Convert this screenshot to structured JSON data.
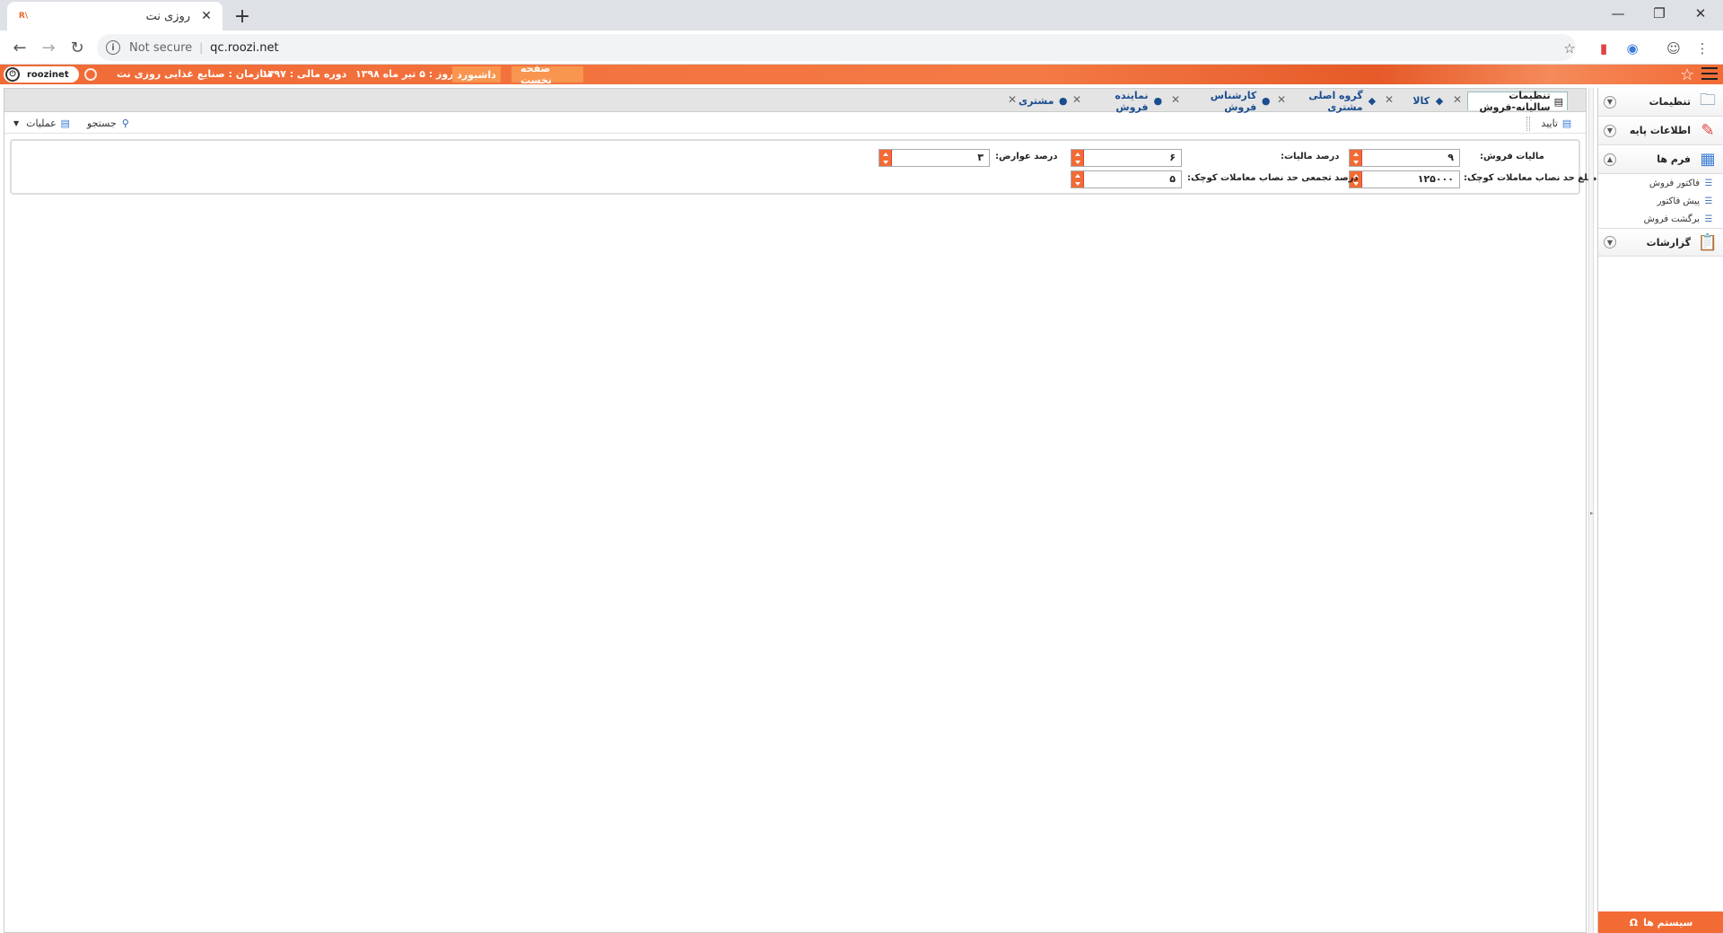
{
  "browser": {
    "tab_title": "روزی نت",
    "favicon_text": "R\\",
    "address": {
      "security": "Not secure",
      "url": "qc.roozi.net"
    }
  },
  "header": {
    "logo_text": "roozinet",
    "organization": "سازمان :  صنایع غذایی روزی نت",
    "fiscal_period": "دوره مالی :  ۱۳۹۷",
    "today": "امروز :  ۵ تیر ماه ۱۳۹۸",
    "dashboard_label": "داشبورد",
    "first_page_label": "صفحه نخست",
    "accent_color": "#f26b35"
  },
  "form_tabs": [
    {
      "label": "تنظیمات سالیانه-فروش",
      "icon": "settings-doc-icon"
    },
    {
      "label": "کالا",
      "icon": "goods-icon"
    },
    {
      "label": "گروه اصلی مشتری",
      "icon": "group-icon"
    },
    {
      "label": "کارشناس فروش",
      "icon": "user-icon"
    },
    {
      "label": "نماینده فروش",
      "icon": "user-icon"
    },
    {
      "label": "مشتری",
      "icon": "user-icon"
    }
  ],
  "toolbar": {
    "confirm_label": "تایید",
    "search_label": "جستجو",
    "operations_label": "عملیات"
  },
  "form": {
    "sales_tax_label": "مالیات فروش:",
    "sales_tax_value": "۹",
    "tax_percent_label": "درصد مالیات:",
    "tax_percent_value": "۶",
    "duties_percent_label": "درصد عوارض:",
    "duties_percent_value": "۳",
    "small_threshold_amount_label": "مبلغ حد نصاب معاملات کوچک:",
    "small_threshold_amount_value": "۱۲۵۰۰۰",
    "cumulative_threshold_label": "درصد تجمعی حد نصاب معاملات کوچک:",
    "cumulative_threshold_value": "۵"
  },
  "sidebar": {
    "groups": [
      {
        "label": "تنظیمات",
        "expanded": false
      },
      {
        "label": "اطلاعات پایه",
        "expanded": false
      },
      {
        "label": "فرم ها",
        "expanded": true,
        "items": [
          "فاکتور فروش",
          "پیش فاکتور",
          "برگشت فروش"
        ]
      },
      {
        "label": "گزارشات",
        "expanded": false
      }
    ],
    "footer_label": "سیستم ها"
  }
}
